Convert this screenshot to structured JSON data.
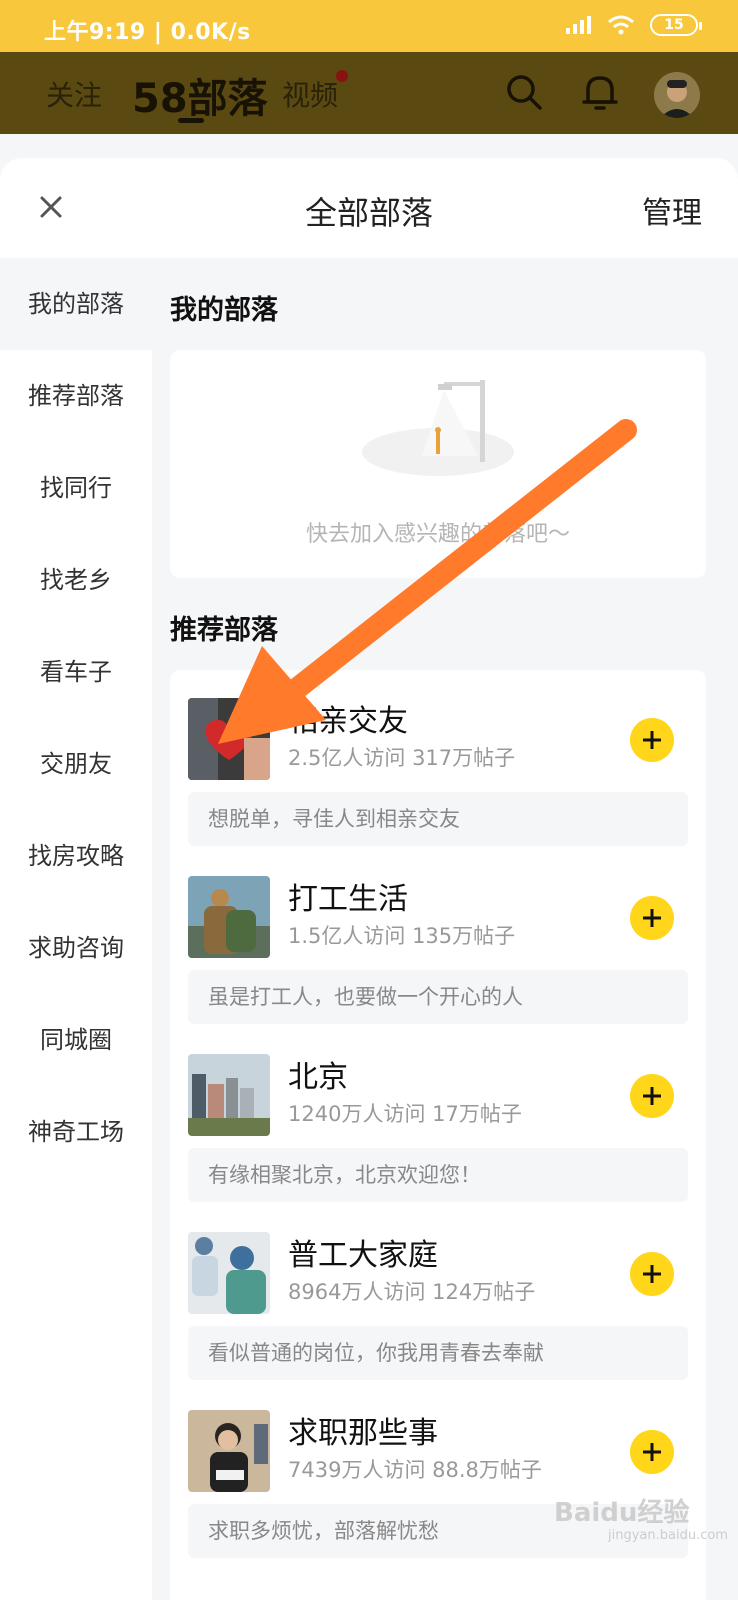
{
  "status": {
    "time": "上午9:19 | 0.0K/s",
    "battery": "15"
  },
  "header": {
    "tabs": [
      "关注",
      "58部落",
      "视频"
    ]
  },
  "modal": {
    "title": "全部部落",
    "manage": "管理"
  },
  "sidebar": {
    "items": [
      "我的部落",
      "推荐部落",
      "找同行",
      "找老乡",
      "看车子",
      "交朋友",
      "找房攻略",
      "求助咨询",
      "同城圈",
      "神奇工场"
    ]
  },
  "content": {
    "my_title": "我的部落",
    "empty_text": "快去加入感兴趣的部落吧～",
    "rec_title": "推荐部落"
  },
  "tribes": [
    {
      "name": "相亲交友",
      "stats": "2.5亿人访问  317万帖子",
      "desc": "想脱单，寻佳人到相亲交友"
    },
    {
      "name": "打工生活",
      "stats": "1.5亿人访问  135万帖子",
      "desc": "虽是打工人，也要做一个开心的人"
    },
    {
      "name": "北京",
      "stats": "1240万人访问  17万帖子",
      "desc": "有缘相聚北京，北京欢迎您！"
    },
    {
      "name": "普工大家庭",
      "stats": "8964万人访问  124万帖子",
      "desc": "看似普通的岗位，你我用青春去奉献"
    },
    {
      "name": "求职那些事",
      "stats": "7439万人访问  88.8万帖子",
      "desc": "求职多烦忧，部落解忧愁"
    }
  ],
  "watermark": {
    "brand": "Baidu经验",
    "url": "jingyan.baidu.com"
  },
  "colors": {
    "accent": "#ffd61a",
    "status_bar": "#f8c73c",
    "arrow": "#ff7a2a"
  }
}
